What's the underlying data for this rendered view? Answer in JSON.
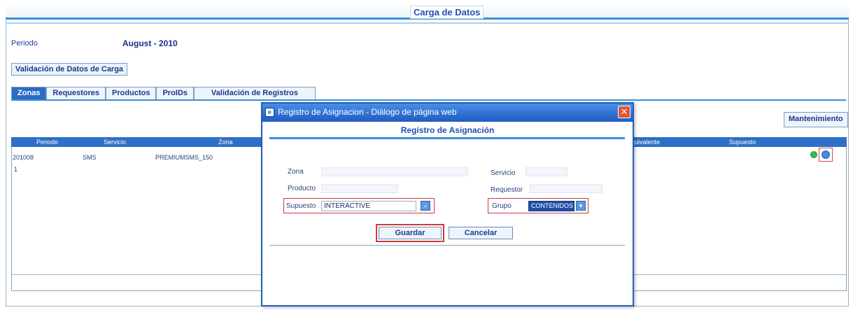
{
  "page": {
    "title": "Carga de Datos",
    "periodo_label": "Periodo",
    "periodo_value": "August - 2010",
    "validacion_button": "Validación de Datos de Carga",
    "mantenimiento_button": "Mantenimiento"
  },
  "tabs": [
    {
      "label": "Zonas",
      "active": true
    },
    {
      "label": "Requestores",
      "active": false
    },
    {
      "label": "Productos",
      "active": false
    },
    {
      "label": "ProIDs",
      "active": false
    },
    {
      "label": "Validación de Registros",
      "active": false
    }
  ],
  "grid": {
    "headers": [
      "Periodo",
      "Servicio",
      "Zona",
      "Equivalente",
      "Supuesto"
    ],
    "rows": [
      {
        "periodo": "201008",
        "servicio": "SMS",
        "zona": "PREMIUMSMS_150"
      },
      {
        "periodo": "1"
      }
    ]
  },
  "dialog": {
    "window_title": "Registro de Asignacion - Diálogo de página web",
    "close_glyph": "✕",
    "heading": "Registro de Asignación",
    "zona_label": "Zona",
    "servicio_label": "Servicio",
    "producto_label": "Producto",
    "requestor_label": "Requestor",
    "supuesto_label": "Supuesto",
    "supuesto_value": "INTERACTIVE",
    "grupo_label": "Grupo",
    "grupo_value": "CONTENIDOS",
    "guardar_button": "Guardar",
    "cancelar_button": "Cancelar"
  },
  "colors": {
    "accent_blue": "#3d8fd6",
    "header_blue": "#2e6fc8",
    "highlight_red": "#cf3a3a"
  },
  "icons": {
    "dialog_app": "ie-page-icon",
    "supuesto_lookup": "search-icon",
    "grupo_dropdown": "chevron-down-icon",
    "row_action_green": "green-dot-icon",
    "row_action_blue": "blue-dot-icon"
  }
}
